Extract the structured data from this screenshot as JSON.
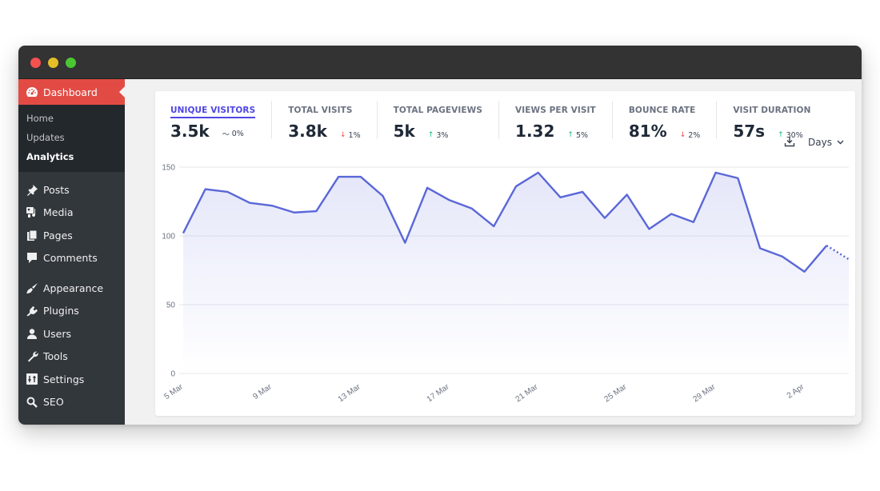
{
  "window": {
    "controls": [
      "close",
      "minimize",
      "maximize"
    ]
  },
  "sidebar": {
    "active": {
      "label": "Dashboard",
      "icon": "dashboard-gauge-icon"
    },
    "submenu": [
      {
        "label": "Home",
        "current": false
      },
      {
        "label": "Updates",
        "current": false
      },
      {
        "label": "Analytics",
        "current": true
      }
    ],
    "items": [
      {
        "label": "Posts",
        "icon": "pushpin-icon"
      },
      {
        "label": "Media",
        "icon": "media-icon"
      },
      {
        "label": "Pages",
        "icon": "pages-icon"
      },
      {
        "label": "Comments",
        "icon": "comment-icon"
      },
      {
        "label": "Appearance",
        "icon": "paintbrush-icon"
      },
      {
        "label": "Plugins",
        "icon": "plugin-icon"
      },
      {
        "label": "Users",
        "icon": "user-icon"
      },
      {
        "label": "Tools",
        "icon": "wrench-icon"
      },
      {
        "label": "Settings",
        "icon": "settings-sliders-icon"
      },
      {
        "label": "SEO",
        "icon": "search-icon"
      }
    ]
  },
  "stats": [
    {
      "label": "UNIQUE VISITORS",
      "value": "3.5k",
      "change": "0%",
      "trend": "flat",
      "active": true
    },
    {
      "label": "TOTAL VISITS",
      "value": "3.8k",
      "change": "1%",
      "trend": "down",
      "active": false
    },
    {
      "label": "TOTAL PAGEVIEWS",
      "value": "5k",
      "change": "3%",
      "trend": "up",
      "active": false
    },
    {
      "label": "VIEWS PER VISIT",
      "value": "1.32",
      "change": "5%",
      "trend": "up",
      "active": false
    },
    {
      "label": "BOUNCE RATE",
      "value": "81%",
      "change": "2%",
      "trend": "down",
      "active": false
    },
    {
      "label": "VISIT DURATION",
      "value": "57s",
      "change": "30%",
      "trend": "up",
      "active": false
    }
  ],
  "toolbar": {
    "download_icon": "download-icon",
    "interval_label": "Days"
  },
  "colors": {
    "accent": "#4f46e5",
    "line": "#5a67d8",
    "sidebar_active": "#e24b44",
    "trend_up": "#10b981",
    "trend_down": "#ef4444"
  },
  "chart_data": {
    "type": "area",
    "title": "",
    "xlabel": "",
    "ylabel": "",
    "ylim": [
      0,
      150
    ],
    "yticks": [
      0,
      50,
      100,
      150
    ],
    "grid": true,
    "x": [
      "5 Mar",
      "6 Mar",
      "7 Mar",
      "8 Mar",
      "9 Mar",
      "10 Mar",
      "11 Mar",
      "12 Mar",
      "13 Mar",
      "14 Mar",
      "15 Mar",
      "16 Mar",
      "17 Mar",
      "18 Mar",
      "19 Mar",
      "20 Mar",
      "21 Mar",
      "22 Mar",
      "23 Mar",
      "24 Mar",
      "25 Mar",
      "26 Mar",
      "27 Mar",
      "28 Mar",
      "29 Mar",
      "30 Mar",
      "31 Mar",
      "1 Apr",
      "2 Apr",
      "3 Apr",
      "4 Apr"
    ],
    "xtick_labels": [
      "5 Mar",
      "9 Mar",
      "13 Mar",
      "17 Mar",
      "21 Mar",
      "25 Mar",
      "29 Mar",
      "2 Apr"
    ],
    "series": [
      {
        "name": "Unique visitors",
        "values": [
          102,
          134,
          132,
          124,
          122,
          117,
          118,
          143,
          143,
          129,
          95,
          135,
          126,
          120,
          107,
          136,
          146,
          128,
          132,
          113,
          130,
          105,
          116,
          110,
          146,
          142,
          91,
          85,
          74,
          93,
          83
        ],
        "incomplete_last_point": true
      }
    ]
  }
}
